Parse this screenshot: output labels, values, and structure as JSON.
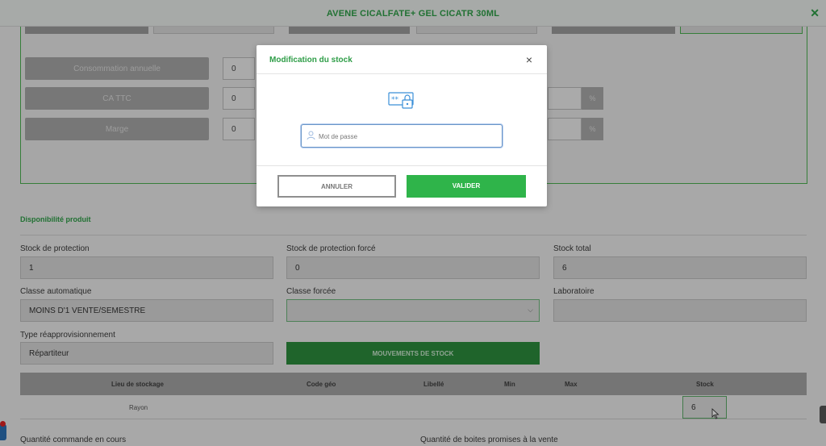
{
  "header": {
    "title": "AVENE CICALFATE+ GEL CICATR 30ML",
    "close_icon": "close-icon"
  },
  "top_form": {
    "rows": [
      {
        "label": "Consommation annuelle",
        "value": "0"
      },
      {
        "label": "CA TTC",
        "value": "0",
        "pct": "%"
      },
      {
        "label": "Marge",
        "value": "0",
        "pct": "%"
      }
    ]
  },
  "modal": {
    "title": "Modification du stock",
    "password_placeholder": "Mot de passe",
    "password_value": "",
    "cancel_label": "ANNULER",
    "confirm_label": "VALIDER"
  },
  "availability": {
    "section_title": "Disponibilité produit",
    "stock_protection_label": "Stock de protection",
    "stock_protection_value": "1",
    "stock_protection_force_label": "Stock de protection forcé",
    "stock_protection_force_value": "0",
    "stock_total_label": "Stock total",
    "stock_total_value": "6",
    "classe_auto_label": "Classe automatique",
    "classe_auto_value": "MOINS D'1 VENTE/SEMESTRE",
    "classe_forcee_label": "Classe forcée",
    "classe_forcee_value": "",
    "laboratoire_label": "Laboratoire",
    "laboratoire_value": "",
    "type_reappro_label": "Type réapprovisionnement",
    "type_reappro_value": "Répartiteur",
    "mouvements_label": "MOUVEMENTS DE STOCK"
  },
  "table": {
    "headers": [
      "Lieu de stockage",
      "Code géo",
      "Libellé",
      "Min",
      "Max",
      "Stock"
    ],
    "rows": [
      {
        "lieu": "Rayon",
        "code_geo": "",
        "libelle": "",
        "min": "",
        "max": "",
        "stock": "6"
      }
    ]
  },
  "bottom": {
    "qty_commande_label": "Quantité commande en cours",
    "qty_promises_label": "Quantité de boites promises à la vente"
  },
  "colors": {
    "accent": "#2e9d47",
    "accent_button": "#2fb44a",
    "input_focus": "#6b96c8"
  }
}
